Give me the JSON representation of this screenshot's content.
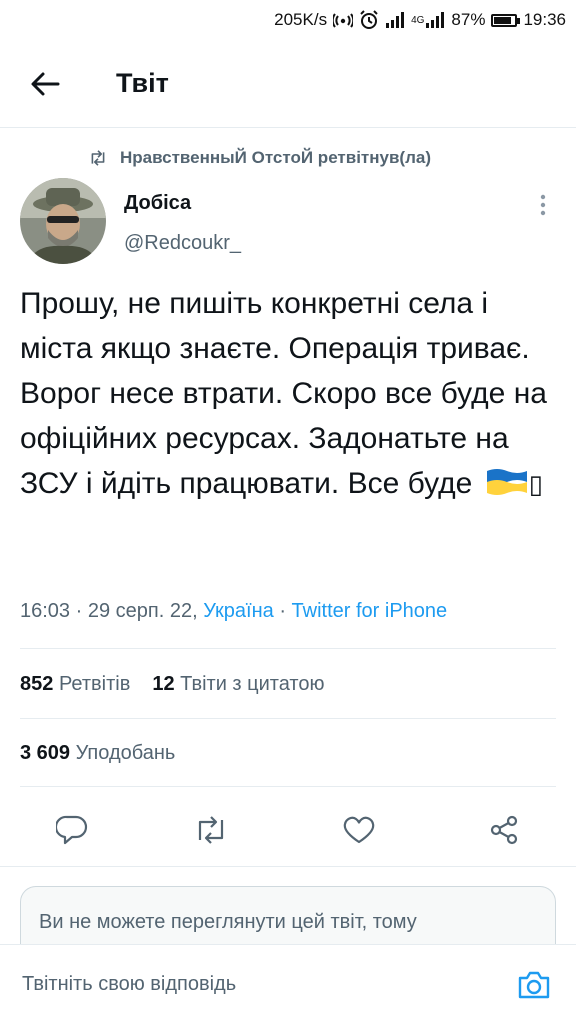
{
  "status_bar": {
    "speed": "205K/s",
    "network": "4G",
    "battery_percent": "87%",
    "battery_level": 0.87,
    "time": "19:36",
    "icons": [
      "hotspot-icon",
      "alarm-icon",
      "signal-icon",
      "signal-4g-icon",
      "battery-icon"
    ]
  },
  "header": {
    "back_icon": "arrow-left-icon",
    "title": "Твіт"
  },
  "retweet": {
    "icon": "retweet-icon",
    "text": "НравственныЙ ОтстоЙ ретвітнув(ла)"
  },
  "tweet": {
    "author_name": "Добіса",
    "author_handle": "@Redcoukr_",
    "text": "Прошу, не пишіть конкретні села і міста якщо знаєте. Операція триває. Ворог несе втрати. Скоро все буде на офіційних ресурсах. Задонатьте на ЗСУ і йдіть працювати. Все буде",
    "emoji": "ukraine-flag-icon",
    "emoji_missing_glyph": "▯",
    "time": "16:03",
    "date": "29 серп. 22,",
    "location": "Україна",
    "separator": "·",
    "source": "Twitter for iPhone"
  },
  "stats": {
    "retweets_count": "852",
    "retweets_label": "Ретвітів",
    "quotes_count": "12",
    "quotes_label": "Твіти з цитатою",
    "likes_count": "3 609",
    "likes_label": "Уподобань"
  },
  "actions": [
    "reply-icon",
    "retweet-icon",
    "like-icon",
    "share-icon"
  ],
  "notice": {
    "text": "Ви не можете переглянути цей твіт, тому"
  },
  "reply": {
    "placeholder": "Твітніть свою відповідь",
    "camera_icon": "camera-icon"
  },
  "colors": {
    "accent": "#1d9bf0",
    "text_primary": "#0f1419",
    "text_secondary": "#536471",
    "divider": "#e6ecf0",
    "flag_blue": "#1a73c8",
    "flag_yellow": "#ffd23c"
  }
}
